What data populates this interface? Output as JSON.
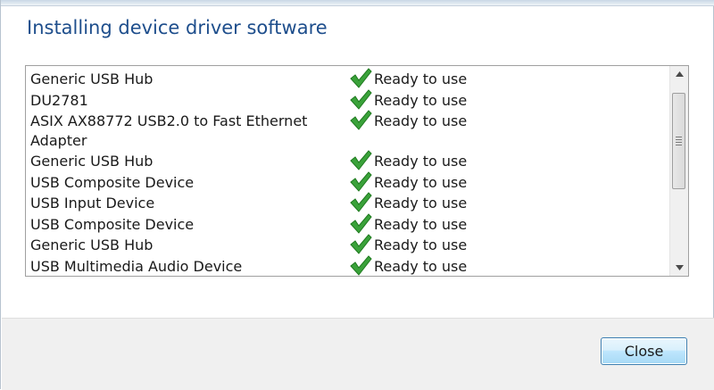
{
  "dialog": {
    "title": "Installing device driver software",
    "close_label": "Close"
  },
  "devices": [
    {
      "name": "Generic USB Hub",
      "status": "Ready to use"
    },
    {
      "name": "DU2781",
      "status": "Ready to use"
    },
    {
      "name": "ASIX AX88772 USB2.0 to Fast Ethernet Adapter",
      "status": "Ready to use"
    },
    {
      "name": "Generic USB Hub",
      "status": "Ready to use"
    },
    {
      "name": "USB Composite Device",
      "status": "Ready to use"
    },
    {
      "name": "USB Input Device",
      "status": "Ready to use"
    },
    {
      "name": "USB Composite Device",
      "status": "Ready to use"
    },
    {
      "name": "Generic USB Hub",
      "status": "Ready to use"
    },
    {
      "name": "USB Multimedia Audio Device",
      "status": "Ready to use"
    }
  ],
  "icons": {
    "status": "green-checkmark-icon",
    "scroll_up": "scroll-up-arrow-icon",
    "scroll_down": "scroll-down-arrow-icon"
  },
  "colors": {
    "title": "#1e4e8c",
    "check": "#3aa23a",
    "button_border": "#3c7fb1"
  }
}
